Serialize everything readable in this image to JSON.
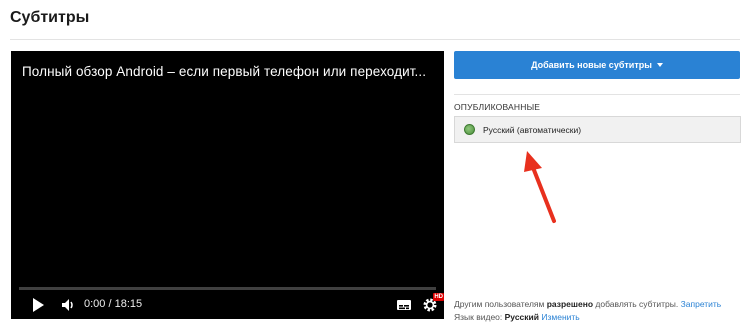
{
  "page": {
    "title": "Субтитры"
  },
  "player": {
    "video_title": "Полный обзор Android – если первый телефон или переходит...",
    "time": "0:00 / 18:15",
    "progress": 0.0,
    "hd_label": "HD",
    "icons": [
      "play-icon",
      "volume-icon",
      "captions-icon",
      "settings-icon"
    ]
  },
  "panel": {
    "add_button_label": "Добавить новые субтитры",
    "published_label": "ОПУБЛИКОВАННЫЕ",
    "track_label": "Русский (автоматически)"
  },
  "footer": {
    "contrib_prefix": "Другим пользователям ",
    "contrib_bold": "разрешено",
    "contrib_suffix": " добавлять субтитры.",
    "contrib_link": "Запретить",
    "lang_prefix": "Язык видео: ",
    "lang_value": "Русский",
    "lang_link": "Изменить"
  },
  "colors": {
    "accent": "#2a82d4",
    "arrow": "#e8301e",
    "track_dot": "#4c8f3c"
  }
}
